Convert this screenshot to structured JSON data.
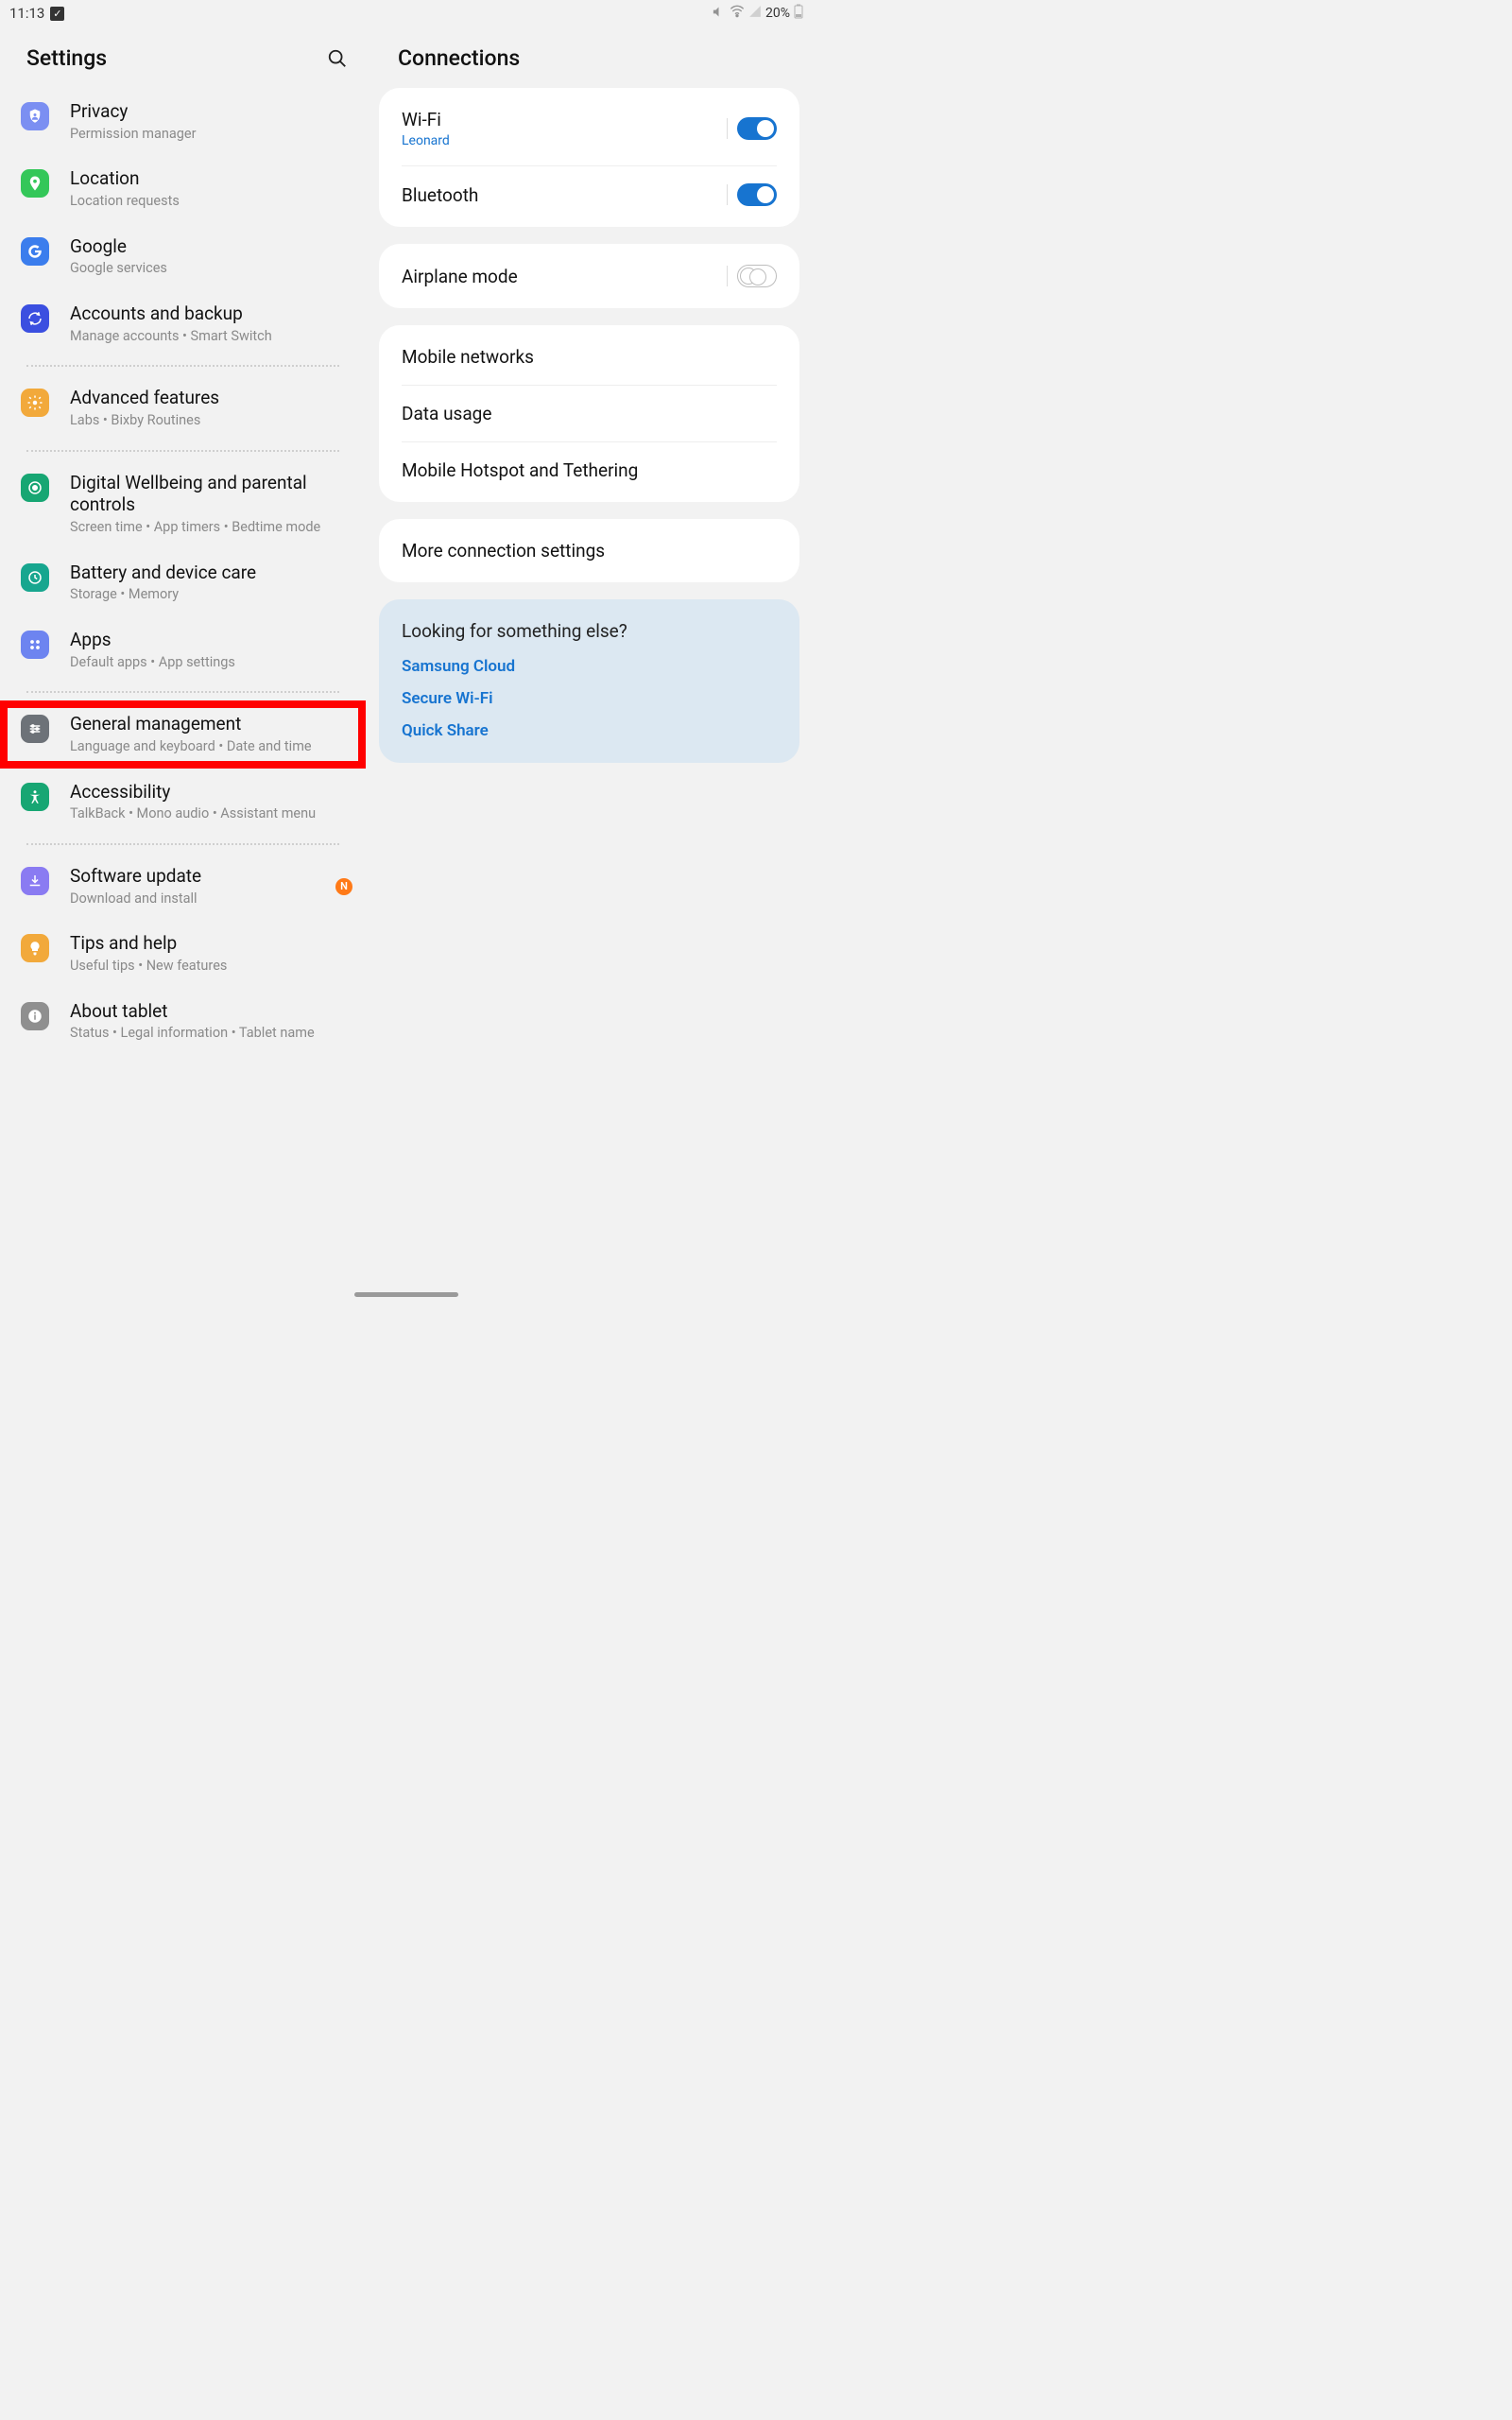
{
  "status": {
    "time": "11:13",
    "battery": "20%"
  },
  "left": {
    "header": "Settings",
    "items": [
      {
        "id": "privacy",
        "title": "Privacy",
        "sub": "Permission manager",
        "color": "#7b8ff2"
      },
      {
        "id": "location",
        "title": "Location",
        "sub": "Location requests",
        "color": "#34c759"
      },
      {
        "id": "google",
        "title": "Google",
        "sub": "Google services",
        "color": "#3b7ded"
      },
      {
        "id": "accounts",
        "title": "Accounts and backup",
        "sub": "Manage accounts  •  Smart Switch",
        "color": "#3b4fe0"
      },
      {
        "id": "advanced",
        "title": "Advanced features",
        "sub": "Labs  •  Bixby Routines",
        "color": "#f2a93b"
      },
      {
        "id": "wellbeing",
        "title": "Digital Wellbeing and parental controls",
        "sub": "Screen time  •  App timers  •  Bedtime mode",
        "color": "#17a673"
      },
      {
        "id": "battery",
        "title": "Battery and device care",
        "sub": "Storage  •  Memory",
        "color": "#17a68f"
      },
      {
        "id": "apps",
        "title": "Apps",
        "sub": "Default apps  •  App settings",
        "color": "#6d84f0"
      },
      {
        "id": "general",
        "title": "General management",
        "sub": "Language and keyboard  •  Date and time",
        "color": "#6d7278"
      },
      {
        "id": "accessibility",
        "title": "Accessibility",
        "sub": "TalkBack  •  Mono audio  •  Assistant menu",
        "color": "#17a673"
      },
      {
        "id": "swupdate",
        "title": "Software update",
        "sub": "Download and install",
        "color": "#8a7bf2",
        "badge": "N"
      },
      {
        "id": "tips",
        "title": "Tips and help",
        "sub": "Useful tips  •  New features",
        "color": "#f2a93b"
      },
      {
        "id": "about",
        "title": "About tablet",
        "sub": "Status  •  Legal information  •  Tablet name",
        "color": "#8f8f8f"
      }
    ],
    "dividers_after": [
      "accounts",
      "advanced",
      "apps",
      "accessibility"
    ],
    "highlight": "general"
  },
  "right": {
    "header": "Connections",
    "group1": {
      "wifi": {
        "title": "Wi-Fi",
        "sub": "Leonard",
        "on": true
      },
      "bt": {
        "title": "Bluetooth",
        "on": true
      }
    },
    "group2": {
      "airplane": {
        "title": "Airplane mode",
        "on": false
      }
    },
    "group3": {
      "mobile": {
        "title": "Mobile networks"
      },
      "data": {
        "title": "Data usage"
      },
      "hotspot": {
        "title": "Mobile Hotspot and Tethering"
      }
    },
    "group4": {
      "more": {
        "title": "More connection settings"
      }
    },
    "info": {
      "title": "Looking for something else?",
      "links": [
        "Samsung Cloud",
        "Secure Wi-Fi",
        "Quick Share"
      ]
    }
  }
}
